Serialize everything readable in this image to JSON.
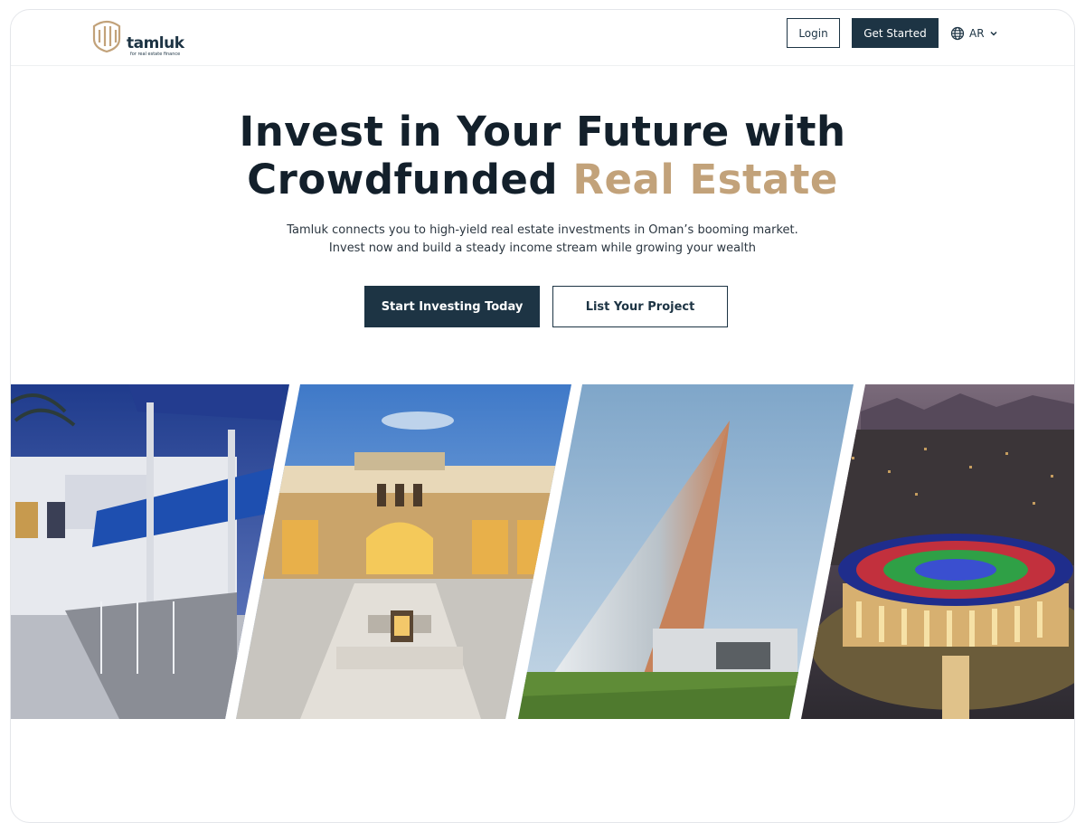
{
  "header": {
    "logo": {
      "name": "tamluk",
      "tagline": "for real estate finance"
    },
    "login_label": "Login",
    "get_started_label": "Get Started",
    "language": {
      "icon": "globe-icon",
      "label": "AR",
      "chevron": "chevron-down-icon"
    }
  },
  "hero": {
    "title_line1": "Invest in Your Future with",
    "title_line2_plain": "Crowdfunded ",
    "title_line2_accent": "Real Estate",
    "subtitle_line1": "Tamluk connects you to high-yield real estate investments in Oman’s booming market.",
    "subtitle_line2": "Invest now and build a steady income stream while growing your wealth",
    "primary_cta": "Start Investing Today",
    "secondary_cta": "List Your Project"
  },
  "gallery": {
    "photos": [
      {
        "subject": "white villa with blue shade canopy at dusk"
      },
      {
        "subject": "illuminated courtyard hotel with arched entrance"
      },
      {
        "subject": "angular sail-shaped modern building"
      },
      {
        "subject": "aerial night view of domed arena with colourful roof"
      }
    ]
  },
  "colors": {
    "brand_navy": "#1d3444",
    "accent_gold": "#c2a27a",
    "text_dark": "#13202b"
  }
}
